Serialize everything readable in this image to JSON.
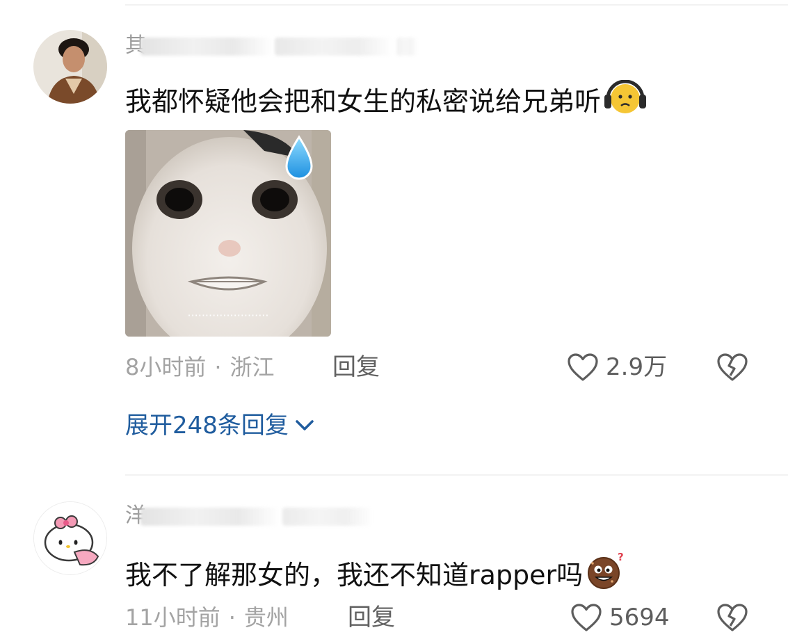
{
  "comments": [
    {
      "user_initial": "其",
      "text": "我都怀疑他会把和女生的私密说给兄弟听",
      "emoji": "headphones-face-emoji",
      "has_image": true,
      "image_caption": "·······················",
      "time": "8小时前",
      "location": "浙江",
      "reply_label": "回复",
      "likes": "2.9万"
    },
    {
      "user_initial": "洋",
      "text": "我不了解那女的，我还不知道rapper吗",
      "emoji": "confused-cookie-emoji",
      "has_image": false,
      "time": "11小时前",
      "location": "贵州",
      "reply_label": "回复",
      "likes": "5694"
    }
  ],
  "expand_replies": "展开248条回复",
  "separator": "·",
  "colors": {
    "link": "#1f5c9e",
    "meta": "#a3a3a3",
    "text": "#111111"
  },
  "icons": {
    "like": "heart-outline-icon",
    "dislike": "broken-heart-icon",
    "expand": "chevron-down-icon"
  }
}
